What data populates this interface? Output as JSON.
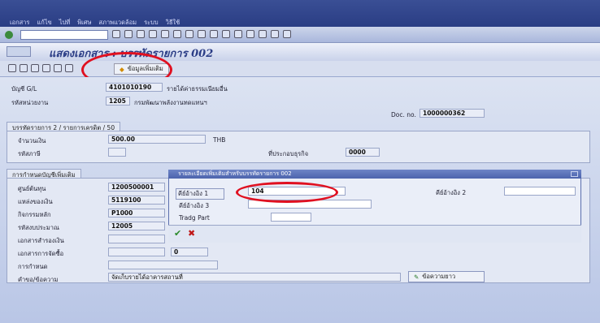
{
  "menu": {
    "items": [
      "เอกสาร",
      "แก้ไข",
      "ไปที่",
      "พิเศษ",
      "สภาพแวดล้อม",
      "ระบบ",
      "วิธีใช้"
    ]
  },
  "page": {
    "title": "แสดงเอกสาร : บรรทัดรายการ 002"
  },
  "app_toolbar": {
    "more_data_label": "ข้อมูลเพิ่มเติม"
  },
  "header": {
    "gl_label": "บัญชี G/L",
    "gl_value": "4101010190",
    "gl_desc": "รายได้ค่าธรรมเนียมอื่น",
    "unit_label": "รหัสหน่วยงาน",
    "unit_value": "1205",
    "unit_desc": "กรมพัฒนาพลังงานทดแทนฯ",
    "doc_label": "Doc. no.",
    "doc_value": "1000000362"
  },
  "item": {
    "group_title": "บรรทัดรายการ 2 / รายการเครดิต / 50",
    "amount_label": "จำนวนเงิน",
    "amount_value": "500.00",
    "currency": "THB",
    "tax_label": "รหัสภาษี",
    "bp_label": "ที่ประกอบธุรกิจ",
    "bp_value": "0000"
  },
  "additional": {
    "group_title": "การกำหนดบัญชีเพิ่มเติม",
    "rows": [
      {
        "label": "ศูนย์ต้นทุน",
        "value": "1200500001"
      },
      {
        "label": "แหล่งของเงิน",
        "value": "5119100"
      },
      {
        "label": "กิจกรรมหลัก",
        "value": "P1000"
      },
      {
        "label": "รหัสงบประมาณ",
        "value": "12005"
      },
      {
        "label": "เอกสารสำรองเงิน",
        "value": ""
      },
      {
        "label": "เอกสารการจัดซื้อ",
        "value": "0"
      },
      {
        "label": "การกำหนด",
        "value": ""
      },
      {
        "label": "คำขอ/ข้อความ",
        "value": "จัดเก็บรายได้อาคารสถานที่"
      }
    ],
    "long_text_button": "ข้อความยาว"
  },
  "popup": {
    "title": "รายละเอียดเพิ่มเติมสำหรับบรรทัดรายการ 002",
    "ref1_label": "คีย์อ้างอิง 1",
    "ref1_value": "104",
    "ref2_label": "คีย์อ้างอิง 2",
    "ref3_label": "คีย์อ้างอิง 3",
    "trading_label": "Tradg Part"
  }
}
